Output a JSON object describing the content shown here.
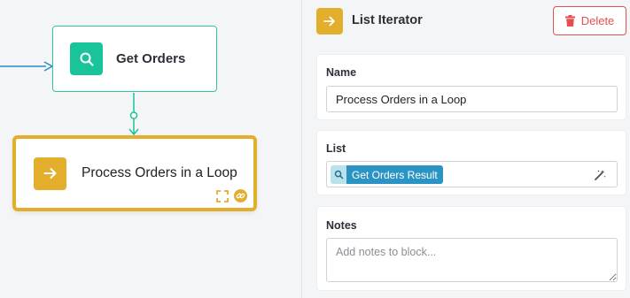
{
  "canvas": {
    "nodes": [
      {
        "title": "Get Orders",
        "icon": "search-icon",
        "color": "#19c49a"
      },
      {
        "title": "Process Orders in a Loop",
        "icon": "arrow-right-icon",
        "color": "#e2ae2b",
        "selected": true
      }
    ],
    "colors": {
      "edge_in": "#2b8cc4",
      "edge_link": "#19c49a",
      "selection": "#e2ae2b"
    }
  },
  "panel": {
    "header": {
      "icon": "arrow-right-icon",
      "title": "List Iterator",
      "delete_label": "Delete"
    },
    "name": {
      "label": "Name",
      "value": "Process Orders in a Loop"
    },
    "list": {
      "label": "List",
      "chip_icon": "search-icon",
      "chip_label": "Get Orders Result",
      "action_icon": "magic-wand-icon"
    },
    "notes": {
      "label": "Notes",
      "placeholder": "Add notes to block...",
      "value": ""
    },
    "colors": {
      "danger": "#e45050",
      "chip": "#2b94c5",
      "accent": "#e2ae2b"
    }
  }
}
